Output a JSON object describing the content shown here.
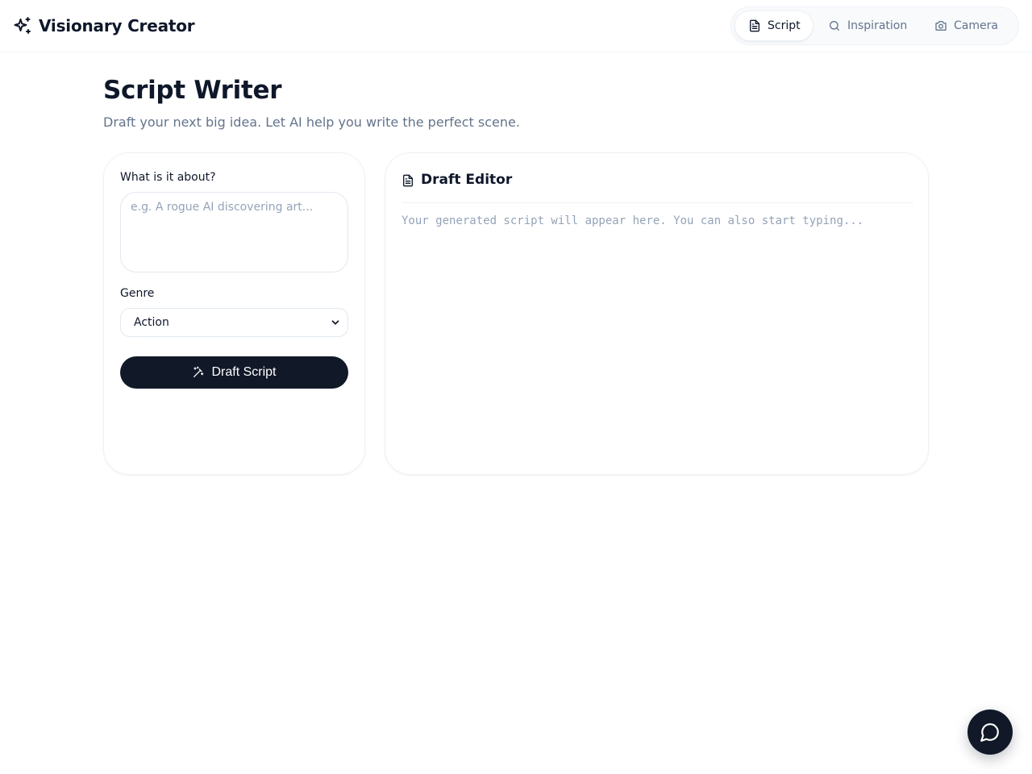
{
  "app": {
    "title": "Visionary Creator",
    "logo_icon": "sparkles-icon"
  },
  "nav": {
    "tabs": [
      {
        "label": "Script",
        "icon": "document-icon",
        "active": true
      },
      {
        "label": "Inspiration",
        "icon": "search-icon",
        "active": false
      },
      {
        "label": "Camera",
        "icon": "camera-icon",
        "active": false
      }
    ]
  },
  "page": {
    "title": "Script Writer",
    "subtitle": "Draft your next big idea. Let AI help you write the perfect scene."
  },
  "form": {
    "about_label": "What is it about?",
    "about_placeholder": "e.g. A rogue AI discovering art...",
    "about_value": "",
    "genre_label": "Genre",
    "genre_selected": "Action",
    "submit_label": "Draft Script",
    "submit_icon": "magic-wand-icon"
  },
  "editor": {
    "title": "Draft Editor",
    "icon": "document-icon",
    "placeholder": "Your generated script will appear here. You can also start typing...",
    "value": ""
  },
  "chat": {
    "icon": "chat-bubble-icon"
  },
  "colors": {
    "primary": "#111827",
    "muted_text": "#64748b",
    "placeholder": "#94a3b8",
    "border": "#e2e8f0"
  }
}
